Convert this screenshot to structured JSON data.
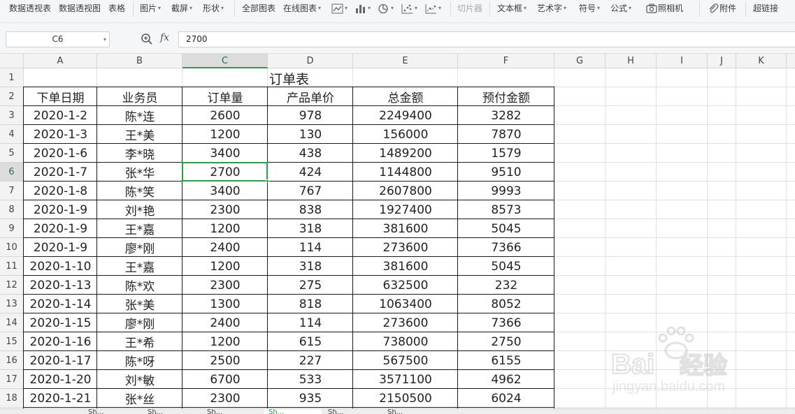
{
  "ribbon": {
    "items": [
      {
        "label": "数据透视表",
        "caret": false
      },
      {
        "label": "数据透视图",
        "caret": false
      },
      {
        "label": "表格",
        "caret": false
      },
      {
        "label": "图片",
        "caret": true
      },
      {
        "label": "截屏",
        "caret": true
      },
      {
        "label": "形状",
        "caret": true
      },
      {
        "label": "全部图表",
        "caret": false
      },
      {
        "label": "在线图表",
        "caret": true
      },
      {
        "label": "切片器",
        "caret": false,
        "disabled": true
      },
      {
        "label": "文本框",
        "caret": true
      },
      {
        "label": "艺术字",
        "caret": true
      },
      {
        "label": "符号",
        "caret": true
      },
      {
        "label": "公式",
        "caret": true
      },
      {
        "label": "照相机",
        "caret": false
      },
      {
        "label": "附件",
        "caret": false
      },
      {
        "label": "超链接",
        "caret": false
      }
    ],
    "chart_icons": [
      "line-chart-icon",
      "bar-chart-icon",
      "pie-chart-icon",
      "scatter-chart-icon",
      "other-chart-icon"
    ]
  },
  "formula_bar": {
    "name_box": "C6",
    "fx_label": "fx",
    "value": "2700"
  },
  "sheet": {
    "columns": [
      "A",
      "B",
      "C",
      "D",
      "E",
      "F",
      "G",
      "H",
      "I",
      "J",
      "K"
    ],
    "row_numbers": [
      "1",
      "2",
      "3",
      "4",
      "5",
      "6",
      "7",
      "8",
      "9",
      "10",
      "11",
      "12",
      "13",
      "14",
      "15",
      "16",
      "17",
      "18"
    ],
    "title": "订单表",
    "headers": [
      "下单日期",
      "业务员",
      "订单量",
      "产品单价",
      "总金额",
      "预付金额"
    ],
    "rows": [
      [
        "2020-1-2",
        "陈*连",
        "2600",
        "978",
        "2249400",
        "3282"
      ],
      [
        "2020-1-3",
        "王*美",
        "1200",
        "130",
        "156000",
        "7870"
      ],
      [
        "2020-1-6",
        "李*晓",
        "3400",
        "438",
        "1489200",
        "1579"
      ],
      [
        "2020-1-7",
        "张*华",
        "2700",
        "424",
        "1144800",
        "9510"
      ],
      [
        "2020-1-8",
        "陈*笑",
        "3400",
        "767",
        "2607800",
        "9993"
      ],
      [
        "2020-1-9",
        "刘*艳",
        "2300",
        "838",
        "1927400",
        "8573"
      ],
      [
        "2020-1-9",
        "王*嘉",
        "1200",
        "318",
        "381600",
        "5045"
      ],
      [
        "2020-1-9",
        "廖*刚",
        "2400",
        "114",
        "273600",
        "7366"
      ],
      [
        "2020-1-10",
        "王*嘉",
        "1200",
        "318",
        "381600",
        "5045"
      ],
      [
        "2020-1-13",
        "陈*欢",
        "2300",
        "275",
        "632500",
        "232"
      ],
      [
        "2020-1-14",
        "张*美",
        "1300",
        "818",
        "1063400",
        "8052"
      ],
      [
        "2020-1-15",
        "廖*刚",
        "2400",
        "114",
        "273600",
        "7366"
      ],
      [
        "2020-1-16",
        "王*希",
        "1200",
        "615",
        "738000",
        "2750"
      ],
      [
        "2020-1-17",
        "陈*呀",
        "2500",
        "227",
        "567500",
        "6155"
      ],
      [
        "2020-1-20",
        "刘*敏",
        "6700",
        "533",
        "3571100",
        "4962"
      ],
      [
        "2020-1-21",
        "张*丝",
        "2300",
        "935",
        "2150500",
        "6024"
      ]
    ],
    "selected_cell": "C6",
    "selected_column": "C",
    "selected_row": "6"
  },
  "sheet_tabs": [
    {
      "label": "Sh...",
      "active": false
    },
    {
      "label": "Sh...",
      "active": false
    },
    {
      "label": "Sh...",
      "active": false
    },
    {
      "label": "Sh...",
      "active": true
    },
    {
      "label": "Sh...",
      "active": false
    },
    {
      "label": "Sh...",
      "active": false
    }
  ],
  "watermark": {
    "brand": "Baidu经验",
    "url": "jingyan.baidu.com"
  },
  "colors": {
    "accent": "#2e9a4a",
    "ribbon_bg": "#f5f6f7",
    "header_bg": "#f3f3f3"
  }
}
